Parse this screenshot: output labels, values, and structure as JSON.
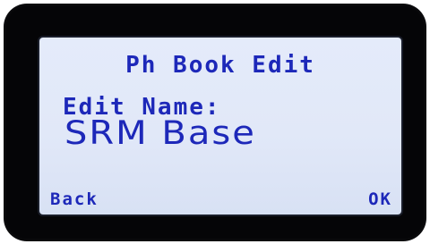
{
  "screen": {
    "title": "Ph Book Edit",
    "field_label": "Edit Name:",
    "field_value": "SRM Base"
  },
  "softkeys": {
    "left": "Back",
    "right": "OK"
  },
  "colors": {
    "lcd_text": "#1d28b9",
    "lcd_background": "#e2e9f9",
    "bezel": "#050507"
  }
}
